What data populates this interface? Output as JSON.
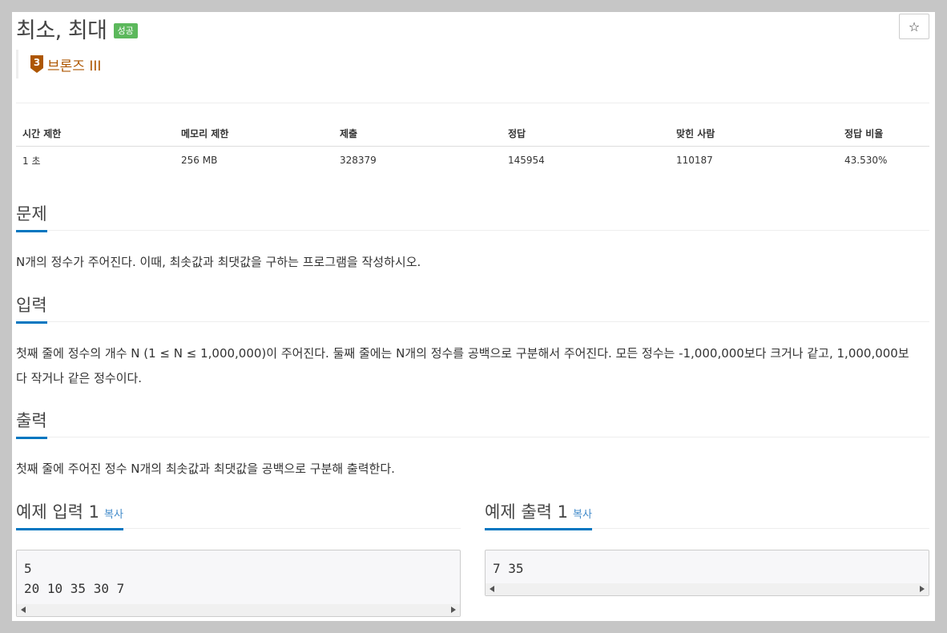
{
  "problem": {
    "title": "최소, 최대",
    "status_badge": "성공",
    "star_icon": "☆",
    "tier": {
      "number": "3",
      "label": "브론즈 III",
      "color": "#ad5600"
    }
  },
  "info_table": {
    "headers": [
      "시간 제한",
      "메모리 제한",
      "제출",
      "정답",
      "맞힌 사람",
      "정답 비율"
    ],
    "values": [
      "1 초",
      "256 MB",
      "328379",
      "145954",
      "110187",
      "43.530%"
    ]
  },
  "sections": {
    "description": {
      "heading": "문제",
      "text": "N개의 정수가 주어진다. 이때, 최솟값과 최댓값을 구하는 프로그램을 작성하시오."
    },
    "input": {
      "heading": "입력",
      "line1": "첫째 줄에 정수의 개수 N (1 ≤ N ≤ 1,000,000)이 주어진다. 둘째 줄에는 N개의 정수를 공백으로 구분해서 주어진다. 모든 정수는 -1,000,000보다 크거나 같고, 1,000,000보",
      "line2": "다 작거나 같은 정수이다."
    },
    "output": {
      "heading": "출력",
      "text": "첫째 줄에 주어진 정수 N개의 최솟값과 최댓값을 공백으로 구분해 출력한다."
    }
  },
  "samples": {
    "input": {
      "heading": "예제 입력 1",
      "copy_label": "복사",
      "lines": [
        "5",
        "20 10 35 30 7"
      ]
    },
    "output": {
      "heading": "예제 출력 1",
      "copy_label": "복사",
      "lines": [
        "7 35"
      ]
    }
  },
  "colors": {
    "success": "#5cb85c",
    "accent": "#0076c0",
    "link": "#428bca",
    "bronze": "#ad5600"
  }
}
